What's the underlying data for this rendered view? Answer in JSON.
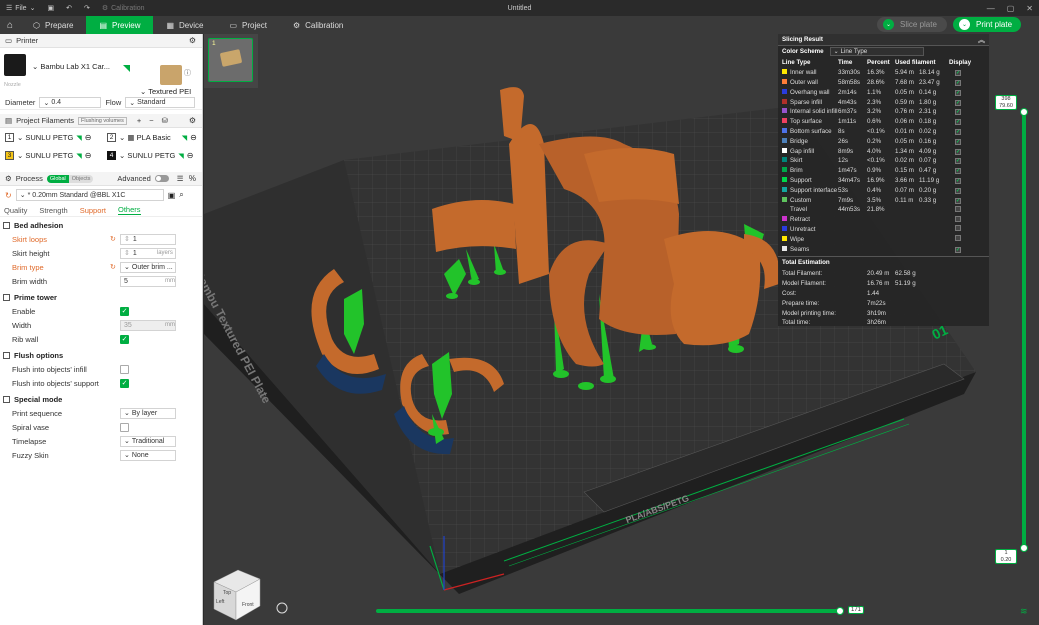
{
  "titlebar": {
    "file_menu": "File",
    "calibration_label": "Calibration",
    "document_title": "Untitled"
  },
  "nav": {
    "tabs": [
      "Prepare",
      "Preview",
      "Device",
      "Project",
      "Calibration"
    ],
    "slice_plate": "Slice plate",
    "print_plate": "Print plate"
  },
  "printer": {
    "section_title": "Printer",
    "printer_name": "Bambu Lab X1 Car...",
    "plate_name": "Textured PEI P...",
    "nozzle_label": "Nozzle",
    "diameter_label": "Diameter",
    "diameter_value": "0.4",
    "flow_label": "Flow",
    "flow_value": "Standard"
  },
  "filaments": {
    "section_title": "Project Filaments",
    "flushing_btn": "Flushing volumes",
    "items": [
      {
        "num": "1",
        "name": "SUNLU PETG",
        "color": "#ffffff"
      },
      {
        "num": "2",
        "name": "PLA Basic",
        "color": "#ffffff"
      },
      {
        "num": "3",
        "name": "SUNLU PETG",
        "color": "#f5c518"
      },
      {
        "num": "4",
        "name": "SUNLU PETG",
        "color": "#111111"
      }
    ]
  },
  "process": {
    "section_title": "Process",
    "toggle_global": "Global",
    "toggle_objects": "Objects",
    "advanced_label": "Advanced",
    "profile": "* 0.20mm Standard @BBL X1C",
    "tabs": [
      "Quality",
      "Strength",
      "Support",
      "Others"
    ]
  },
  "settings": {
    "bed_adhesion": {
      "title": "Bed adhesion",
      "skirt_loops_label": "Skirt loops",
      "skirt_loops_value": "1",
      "skirt_height_label": "Skirt height",
      "skirt_height_value": "1",
      "skirt_height_unit": "layers",
      "brim_type_label": "Brim type",
      "brim_type_value": "Outer brim ...",
      "brim_width_label": "Brim width",
      "brim_width_value": "5",
      "brim_width_unit": "mm"
    },
    "prime_tower": {
      "title": "Prime tower",
      "enable_label": "Enable",
      "width_label": "Width",
      "width_value": "35",
      "width_unit": "mm",
      "rib_wall_label": "Rib wall"
    },
    "flush_options": {
      "title": "Flush options",
      "infill_label": "Flush into objects' infill",
      "support_label": "Flush into objects' support"
    },
    "special_mode": {
      "title": "Special mode",
      "print_sequence_label": "Print sequence",
      "print_sequence_value": "By layer",
      "spiral_vase_label": "Spiral vase",
      "timelapse_label": "Timelapse",
      "timelapse_value": "Traditional",
      "fuzzy_skin_label": "Fuzzy Skin",
      "fuzzy_skin_value": "None"
    }
  },
  "slicing_result": {
    "title": "Slicing Result",
    "color_scheme_label": "Color Scheme",
    "color_scheme_value": "Line Type",
    "headers": [
      "Line Type",
      "Time",
      "Percent",
      "Used filament",
      "Display"
    ],
    "rows": [
      {
        "name": "Inner wall",
        "color": "#ffe600",
        "time": "33m30s",
        "pct": "16.3%",
        "m": "5.94 m",
        "g": "18.14 g"
      },
      {
        "name": "Outer wall",
        "color": "#ff7d38",
        "time": "58m58s",
        "pct": "28.6%",
        "m": "7.68 m",
        "g": "23.47 g"
      },
      {
        "name": "Overhang wall",
        "color": "#2a3cdc",
        "time": "2m14s",
        "pct": "1.1%",
        "m": "0.05 m",
        "g": "0.14 g"
      },
      {
        "name": "Sparse infill",
        "color": "#b03029",
        "time": "4m43s",
        "pct": "2.3%",
        "m": "0.59 m",
        "g": "1.80 g"
      },
      {
        "name": "Internal solid infill",
        "color": "#9654cc",
        "time": "6m37s",
        "pct": "3.2%",
        "m": "0.76 m",
        "g": "2.31 g"
      },
      {
        "name": "Top surface",
        "color": "#f04060",
        "time": "1m11s",
        "pct": "0.6%",
        "m": "0.06 m",
        "g": "0.18 g"
      },
      {
        "name": "Bottom surface",
        "color": "#4d72e8",
        "time": "8s",
        "pct": "<0.1%",
        "m": "0.01 m",
        "g": "0.02 g"
      },
      {
        "name": "Bridge",
        "color": "#4d80ba",
        "time": "26s",
        "pct": "0.2%",
        "m": "0.05 m",
        "g": "0.16 g"
      },
      {
        "name": "Gap infill",
        "color": "#ffffff",
        "time": "8m9s",
        "pct": "4.0%",
        "m": "1.34 m",
        "g": "4.09 g"
      },
      {
        "name": "Skirt",
        "color": "#00877a",
        "time": "12s",
        "pct": "<0.1%",
        "m": "0.02 m",
        "g": "0.07 g"
      },
      {
        "name": "Brim",
        "color": "#00a84a",
        "time": "1m47s",
        "pct": "0.9%",
        "m": "0.15 m",
        "g": "0.47 g"
      },
      {
        "name": "Support",
        "color": "#00d84a",
        "time": "34m47s",
        "pct": "16.9%",
        "m": "3.66 m",
        "g": "11.19 g"
      },
      {
        "name": "Support interface",
        "color": "#13a89e",
        "time": "53s",
        "pct": "0.4%",
        "m": "0.07 m",
        "g": "0.20 g"
      },
      {
        "name": "Custom",
        "color": "#5ec45e",
        "time": "7m9s",
        "pct": "3.5%",
        "m": "0.11 m",
        "g": "0.33 g"
      },
      {
        "name": "Travel",
        "color": "",
        "time": "44m53s",
        "pct": "21.8%",
        "m": "",
        "g": ""
      },
      {
        "name": "Retract",
        "color": "#cc33cc",
        "time": "",
        "pct": "",
        "m": "",
        "g": ""
      },
      {
        "name": "Unretract",
        "color": "#2a3cdc",
        "time": "",
        "pct": "",
        "m": "",
        "g": ""
      },
      {
        "name": "Wipe",
        "color": "#ffe600",
        "time": "",
        "pct": "",
        "m": "",
        "g": ""
      },
      {
        "name": "Seams",
        "color": "#e8e8e8",
        "time": "",
        "pct": "",
        "m": "",
        "g": ""
      }
    ],
    "total_title": "Total Estimation",
    "totals": [
      {
        "label": "Total Filament:",
        "m": "20.49 m",
        "g": "62.58 g"
      },
      {
        "label": "Model Filament:",
        "m": "16.76 m",
        "g": "51.19 g"
      },
      {
        "label": "Cost:",
        "m": "1.44",
        "g": ""
      },
      {
        "label": "Prepare time:",
        "m": "7m22s",
        "g": ""
      },
      {
        "label": "Model printing time:",
        "m": "3h19m",
        "g": ""
      },
      {
        "label": "Total time:",
        "m": "3h26m",
        "g": ""
      }
    ]
  },
  "viewport": {
    "plate_text": "Bambu Textured PEI Plate",
    "plate_number": "01",
    "plate_material": "PLA/ABS/PETG",
    "thumb_number": "1",
    "layer_top_value": "398",
    "layer_top_height": "79.60",
    "layer_bottom_value": "1",
    "layer_bottom_height": "0.20",
    "move_value": "171",
    "layer_position_fraction": 1.0,
    "move_position_fraction": 1.0,
    "cube_labels": [
      "Top",
      "Front",
      "Left"
    ]
  }
}
